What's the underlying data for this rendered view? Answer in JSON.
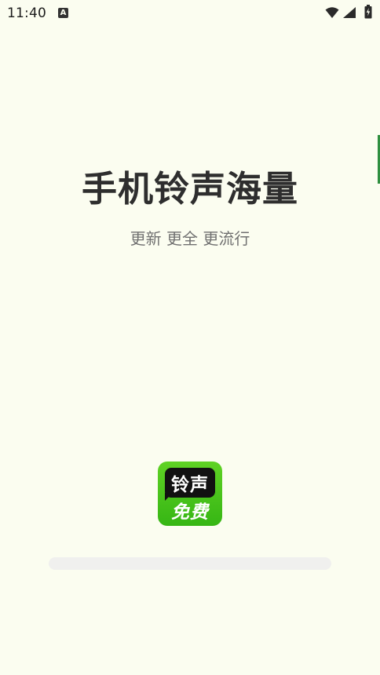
{
  "status_bar": {
    "time": "11:40",
    "notification_icon": "a-letter-icon",
    "a_letter": "A",
    "wifi_icon": "wifi-icon",
    "signal_icon": "signal-icon",
    "battery_icon": "battery-charging-icon"
  },
  "splash": {
    "title": "手机铃声海量",
    "subtitle": "更新 更全 更流行"
  },
  "logo": {
    "line1": "铃声",
    "line2": "免费"
  },
  "progress": {
    "fraction": 0
  },
  "colors": {
    "background": "#fbfdf0",
    "title": "#2e2e2e",
    "subtitle": "#707070",
    "logo_green": "#4cc41d",
    "progress_track": "#f0f0ee"
  }
}
